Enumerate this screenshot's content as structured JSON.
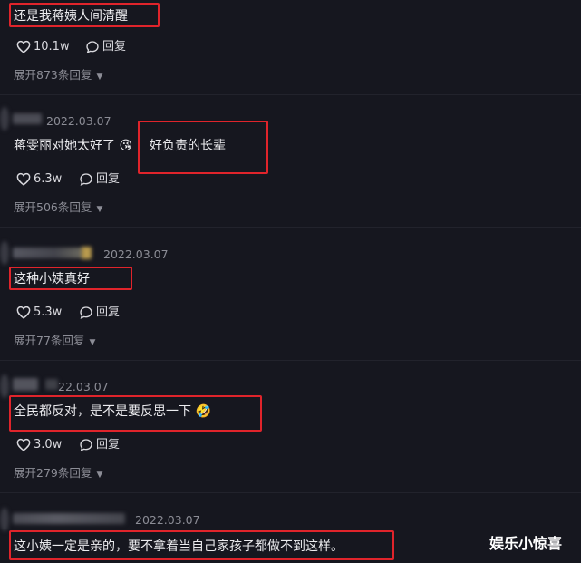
{
  "comments": [
    {
      "text": "还是我蒋姨人间清醒",
      "likes": "10.1w",
      "reply_label": "回复",
      "expand": "展开873条回复"
    },
    {
      "date": "2022.03.07",
      "text": "蒋雯丽对她太好了",
      "emoji": "😘",
      "likes": "6.3w",
      "reply_label": "回复",
      "expand": "展开506条回复"
    },
    {
      "date": "2022.03.07",
      "text": "这种小姨真好",
      "likes": "5.3w",
      "reply_label": "回复",
      "expand": "展开77条回复"
    },
    {
      "date": "22.03.07",
      "text": "全民都反对，是不是要反思一下",
      "emoji": "🤣",
      "likes": "3.0w",
      "reply_label": "回复",
      "expand": "展开279条回复"
    },
    {
      "date": "2022.03.07",
      "text": "这小姨一定是亲的，要不拿着当自己家孩子都做不到这样。"
    }
  ],
  "annotation": {
    "text": "好负责的长辈"
  },
  "watermark": "娱乐小惊喜",
  "colors": {
    "background": "#16171f",
    "highlight_box": "#e0242b",
    "muted_text": "#8c8d96"
  }
}
